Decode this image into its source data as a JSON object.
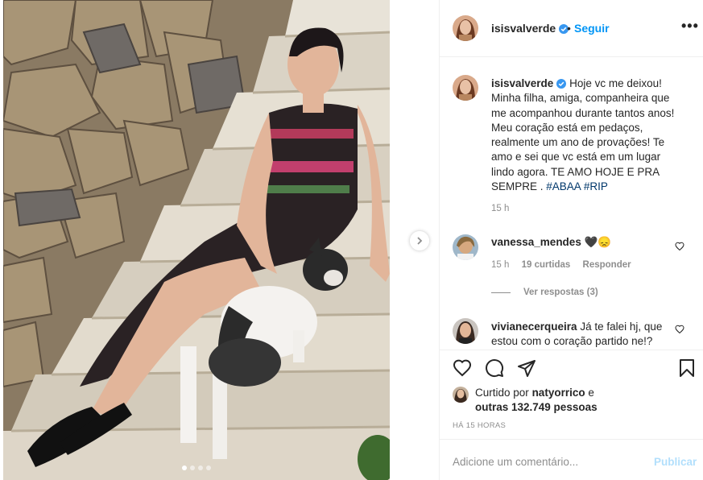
{
  "post": {
    "username": "isisvalverde",
    "separator": "•",
    "follow_label": "Seguir",
    "more_label": "•••"
  },
  "caption": {
    "username": "isisvalverde",
    "text": "Hoje vc me deixou! Minha filha, amiga, companheira que me acompanhou durante tantos anos! Meu coração está em pedaços, realmente um ano de provações! Te amo e sei que vc está em um lugar lindo agora. TE AMO HOJE E PRA SEMPRE . ",
    "hashtags": [
      "#ABAA",
      "#RIP"
    ],
    "time": "15 h"
  },
  "comments": [
    {
      "username": "vanessa_mendes",
      "text": "🖤😞",
      "time": "15 h",
      "likes": "19 curtidas",
      "reply_label": "Responder",
      "view_replies": "Ver respostas (3)"
    },
    {
      "username": "vivianecerqueira",
      "text": "Já te falei hj, que estou com o coração partido ne!?"
    }
  ],
  "likes": {
    "prefix": "Curtido por",
    "liker": "natyorrico",
    "conj": "e",
    "others": "outras 132.749 pessoas"
  },
  "timeago": "HÁ 15 HORAS",
  "add_comment": {
    "placeholder": "Adicione um comentário...",
    "publish_label": "Publicar"
  },
  "carousel": {
    "total": 4,
    "current": 1
  },
  "colors": {
    "accent": "#0095f6",
    "verified": "#3897f0",
    "publish_disabled": "#b2dffc"
  }
}
